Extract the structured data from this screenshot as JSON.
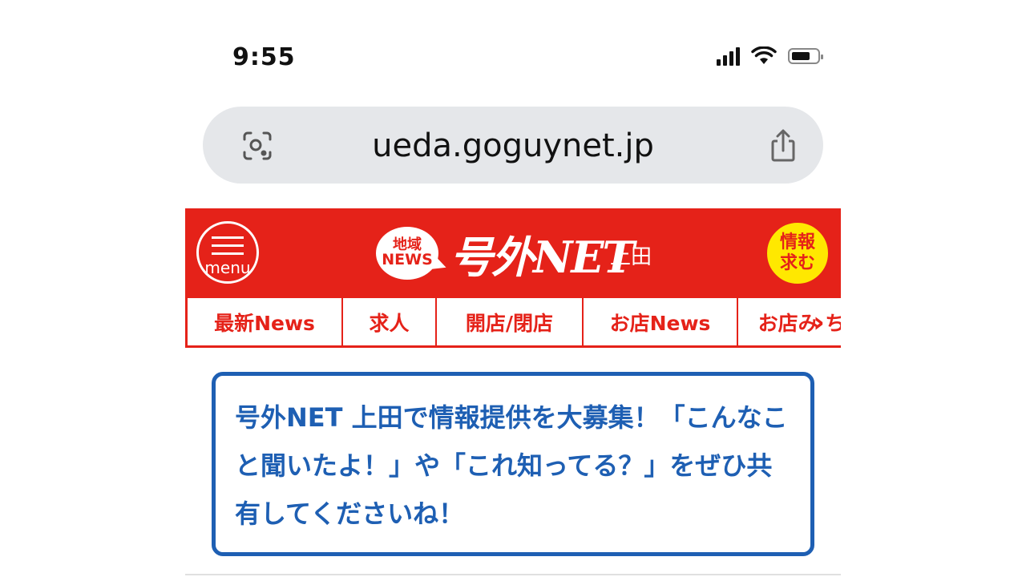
{
  "status_bar": {
    "time": "9:55"
  },
  "browser": {
    "url": "ueda.goguynet.jp"
  },
  "header": {
    "menu_label": "menu",
    "logo_small_top": "地域",
    "logo_small_bottom": "NEWS",
    "logo_main": "号外NET",
    "city": "上田",
    "info_line1": "情報",
    "info_line2": "求む",
    "brand_color": "#e52219",
    "info_color": "#ffe800"
  },
  "nav": {
    "items": [
      {
        "label": "最新News"
      },
      {
        "label": "求人"
      },
      {
        "label": "開店/閉店"
      },
      {
        "label": "お店News"
      },
      {
        "label": "お店み ち"
      }
    ]
  },
  "notice": {
    "text": "号外NET 上田で情報提供を大募集！「こんなこと聞いたよ！」や「これ知ってる？」をぜひ共有してくださいね！",
    "color": "#1e5fb3"
  }
}
